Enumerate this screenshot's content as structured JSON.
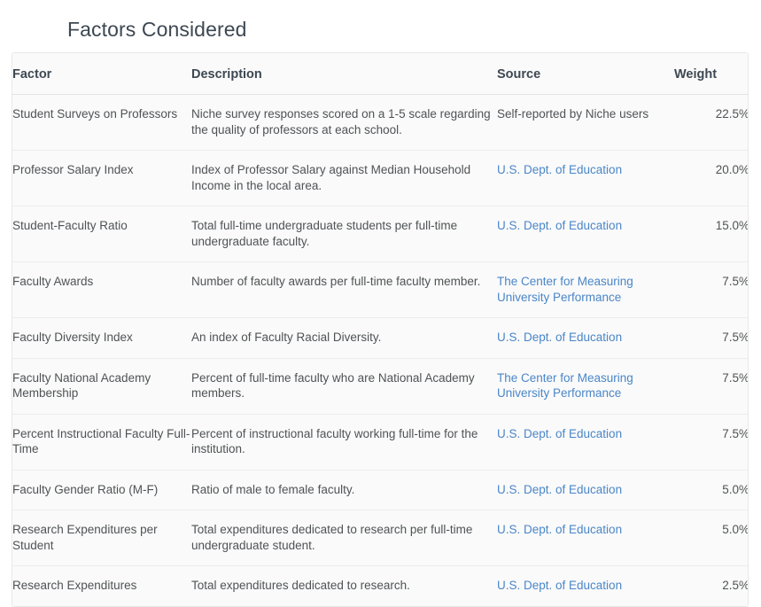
{
  "page": {
    "title": "Factors Considered"
  },
  "table": {
    "columns": [
      {
        "key": "factor",
        "label": "Factor"
      },
      {
        "key": "description",
        "label": "Description"
      },
      {
        "key": "source",
        "label": "Source"
      },
      {
        "key": "weight",
        "label": "Weight"
      }
    ],
    "link_color": "#4a86c8",
    "text_color": "#4f5355",
    "header_color": "#3d4852",
    "border_color": "#e8e8e8",
    "background": "#fafafa",
    "rows": [
      {
        "factor": "Student Surveys on Professors",
        "description": "Niche survey responses scored on a 1-5 scale regarding the quality of professors at each school.",
        "source": "Self-reported by Niche users",
        "source_is_link": false,
        "weight": "22.5%"
      },
      {
        "factor": "Professor Salary Index",
        "description": "Index of Professor Salary against Median Household Income in the local area.",
        "source": "U.S. Dept. of Education",
        "source_is_link": true,
        "weight": "20.0%"
      },
      {
        "factor": "Student-Faculty Ratio",
        "description": "Total full-time undergraduate students per full-time undergraduate faculty.",
        "source": "U.S. Dept. of Education",
        "source_is_link": true,
        "weight": "15.0%"
      },
      {
        "factor": "Faculty Awards",
        "description": "Number of faculty awards per full-time faculty member.",
        "source": "The Center for Measuring University Performance",
        "source_is_link": true,
        "weight": "7.5%"
      },
      {
        "factor": "Faculty Diversity Index",
        "description": "An index of Faculty Racial Diversity.",
        "source": "U.S. Dept. of Education",
        "source_is_link": true,
        "weight": "7.5%"
      },
      {
        "factor": "Faculty National Academy Membership",
        "description": "Percent of full-time faculty who are National Academy members.",
        "source": "The Center for Measuring University Performance",
        "source_is_link": true,
        "weight": "7.5%"
      },
      {
        "factor": "Percent Instructional Faculty Full-Time",
        "description": "Percent of instructional faculty working full-time for the institution.",
        "source": "U.S. Dept. of Education",
        "source_is_link": true,
        "weight": "7.5%"
      },
      {
        "factor": "Faculty Gender Ratio (M-F)",
        "description": "Ratio of male to female faculty.",
        "source": "U.S. Dept. of Education",
        "source_is_link": true,
        "weight": "5.0%"
      },
      {
        "factor": "Research Expenditures per Student",
        "description": "Total expenditures dedicated to research per full-time undergraduate student.",
        "source": "U.S. Dept. of Education",
        "source_is_link": true,
        "weight": "5.0%"
      },
      {
        "factor": "Research Expenditures",
        "description": "Total expenditures dedicated to research.",
        "source": "U.S. Dept. of Education",
        "source_is_link": true,
        "weight": "2.5%"
      }
    ]
  }
}
